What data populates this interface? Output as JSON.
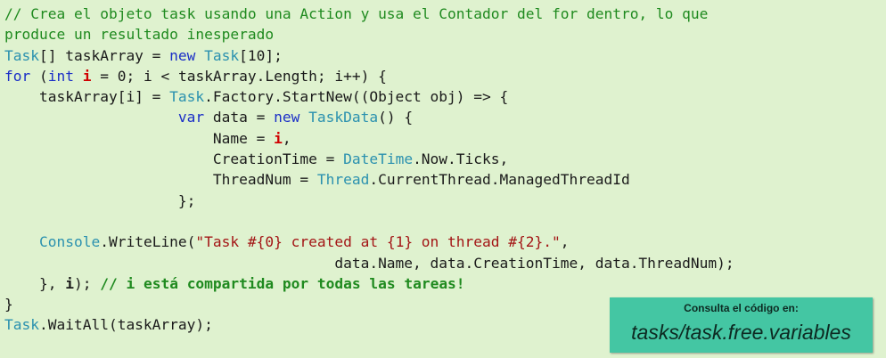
{
  "code": {
    "lines": [
      {
        "segments": [
          {
            "t": "// Crea el objeto task usando una Action y usa el Contador del for dentro, lo que",
            "c": "cm"
          }
        ]
      },
      {
        "segments": [
          {
            "t": "produce un resultado inesperado",
            "c": "cm"
          }
        ]
      },
      {
        "segments": [
          {
            "t": "Task",
            "c": "ty"
          },
          {
            "t": "[] taskArray = ",
            "c": ""
          },
          {
            "t": "new",
            "c": "kw"
          },
          {
            "t": " ",
            "c": ""
          },
          {
            "t": "Task",
            "c": "ty"
          },
          {
            "t": "[10];",
            "c": ""
          }
        ]
      },
      {
        "segments": [
          {
            "t": "for",
            "c": "kw"
          },
          {
            "t": " (",
            "c": ""
          },
          {
            "t": "int",
            "c": "kw"
          },
          {
            "t": " ",
            "c": ""
          },
          {
            "t": "i",
            "c": "var"
          },
          {
            "t": " = 0; i < taskArray.Length; i++) {",
            "c": ""
          }
        ]
      },
      {
        "segments": [
          {
            "t": "    taskArray[i] = ",
            "c": ""
          },
          {
            "t": "Task",
            "c": "ty"
          },
          {
            "t": ".Factory.StartNew((Object obj) => {",
            "c": ""
          }
        ]
      },
      {
        "segments": [
          {
            "t": "                    ",
            "c": ""
          },
          {
            "t": "var",
            "c": "kw"
          },
          {
            "t": " data = ",
            "c": ""
          },
          {
            "t": "new",
            "c": "kw"
          },
          {
            "t": " ",
            "c": ""
          },
          {
            "t": "TaskData",
            "c": "ty"
          },
          {
            "t": "() {",
            "c": ""
          }
        ]
      },
      {
        "segments": [
          {
            "t": "                        Name = ",
            "c": ""
          },
          {
            "t": "i",
            "c": "var"
          },
          {
            "t": ",",
            "c": ""
          }
        ]
      },
      {
        "segments": [
          {
            "t": "                        CreationTime = ",
            "c": ""
          },
          {
            "t": "DateTime",
            "c": "ty"
          },
          {
            "t": ".Now.Ticks,",
            "c": ""
          }
        ]
      },
      {
        "segments": [
          {
            "t": "                        ThreadNum = ",
            "c": ""
          },
          {
            "t": "Thread",
            "c": "ty"
          },
          {
            "t": ".CurrentThread.ManagedThreadId",
            "c": ""
          }
        ]
      },
      {
        "segments": [
          {
            "t": "                    };",
            "c": ""
          }
        ]
      },
      {
        "segments": [
          {
            "t": "",
            "c": ""
          }
        ]
      },
      {
        "segments": [
          {
            "t": "    ",
            "c": ""
          },
          {
            "t": "Console",
            "c": "ty"
          },
          {
            "t": ".WriteLine(",
            "c": ""
          },
          {
            "t": "\"Task #{0} created at {1} on thread #{2}.\"",
            "c": "st"
          },
          {
            "t": ",",
            "c": ""
          }
        ]
      },
      {
        "segments": [
          {
            "t": "                                      data.Name, data.CreationTime, data.ThreadNum);",
            "c": ""
          }
        ]
      },
      {
        "segments": [
          {
            "t": "    }, ",
            "c": ""
          },
          {
            "t": "i",
            "c": "b"
          },
          {
            "t": "); ",
            "c": ""
          },
          {
            "t": "// i está compartida por todas las tareas!",
            "c": "cmb"
          }
        ]
      },
      {
        "segments": [
          {
            "t": "}",
            "c": ""
          }
        ]
      },
      {
        "segments": [
          {
            "t": "Task",
            "c": "ty"
          },
          {
            "t": ".WaitAll(taskArray);",
            "c": ""
          }
        ]
      }
    ]
  },
  "callout": {
    "label": "Consulta el código en:",
    "path": "tasks/task.free.variables"
  }
}
